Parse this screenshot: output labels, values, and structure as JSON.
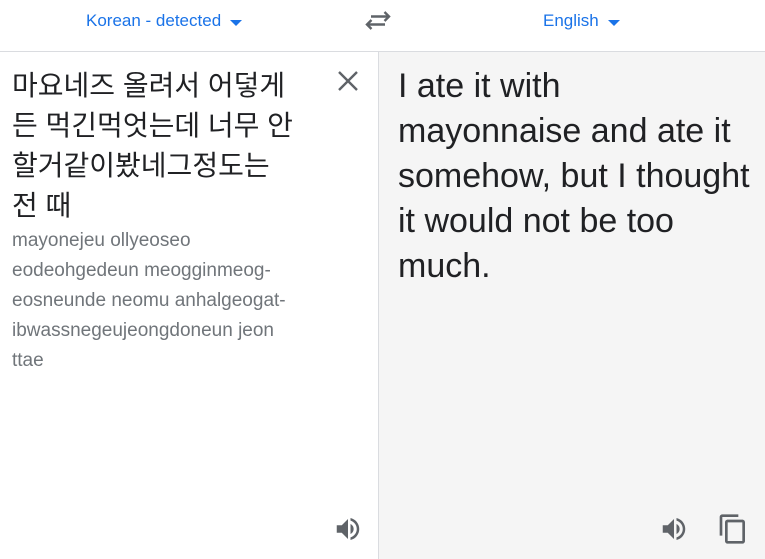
{
  "header": {
    "source_language": "Korean - detected",
    "target_language": "English"
  },
  "source": {
    "text": "마요네즈 올려서 어덯게든 먹긴먹엇는데 너무 안할거같이봤네그정도는 전 때",
    "transliteration": "mayonejeu ollyeoseo eodeohgedeun meogginmeog-eosneunde neomu anhalgeogat-ibwassnegeujeongdoneun jeon ttae"
  },
  "target": {
    "text": "I ate it with mayonnaise and ate it somehow, but I thought it would not be too much."
  },
  "icons": {
    "swap": "swap-arrows-icon",
    "clear": "close-icon",
    "listen": "speaker-icon",
    "copy": "copy-icon"
  },
  "colors": {
    "accent": "#1a73e8",
    "icon": "#5f6368",
    "text": "#202124",
    "secondary_text": "#70757a",
    "result_background": "#f5f5f5"
  }
}
